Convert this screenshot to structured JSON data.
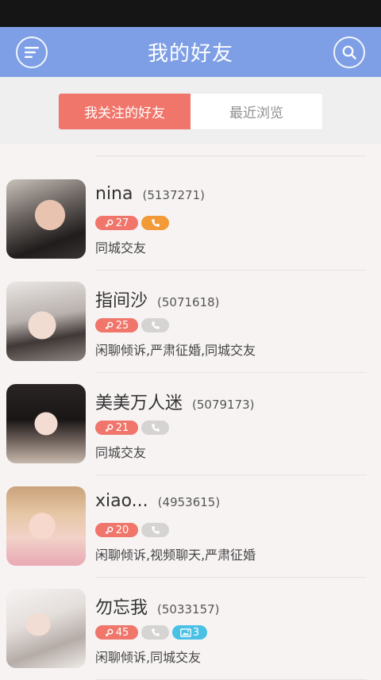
{
  "header": {
    "title": "我的好友"
  },
  "tabs": [
    {
      "label": "我关注的好友",
      "active": true
    },
    {
      "label": "最近浏览",
      "active": false
    }
  ],
  "friends": [
    {
      "name": "nina",
      "uid": "(5137271)",
      "age": "27",
      "phone_verified": true,
      "photo_count": "",
      "tags": "同城交友"
    },
    {
      "name": "指间沙",
      "uid": "(5071618)",
      "age": "25",
      "phone_verified": false,
      "photo_count": "",
      "tags": "闲聊倾诉,严肃征婚,同城交友"
    },
    {
      "name": "美美万人迷",
      "uid": "(5079173)",
      "age": "21",
      "phone_verified": false,
      "photo_count": "",
      "tags": "同城交友"
    },
    {
      "name": "xiao...",
      "uid": "(4953615)",
      "age": "20",
      "phone_verified": false,
      "photo_count": "",
      "tags": "闲聊倾诉,视频聊天,严肃征婚"
    },
    {
      "name": "勿忘我",
      "uid": "(5033157)",
      "age": "45",
      "phone_verified": false,
      "photo_count": "3",
      "tags": "闲聊倾诉,同城交友"
    }
  ],
  "colors": {
    "header": "#7e9fe6",
    "accent": "#f0756a",
    "phone_on": "#f39a38",
    "phone_off": "#d6d3d3",
    "photo": "#4ac0e5"
  },
  "icons": {
    "menu": "menu-icon",
    "search": "search-icon",
    "gender": "female-icon",
    "phone": "phone-icon",
    "photo": "photo-icon"
  }
}
